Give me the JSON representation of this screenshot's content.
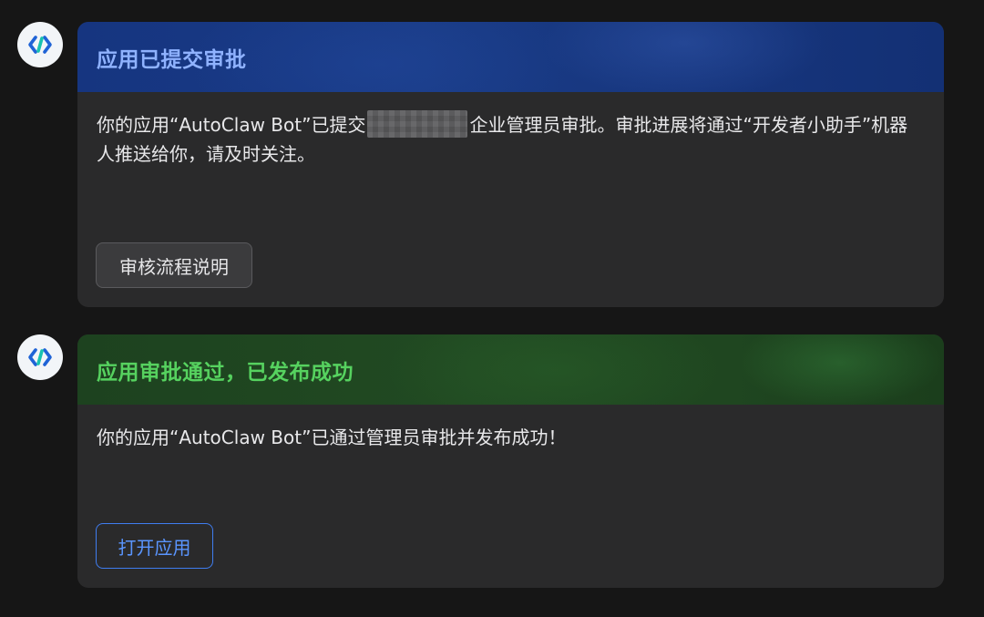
{
  "messages": [
    {
      "avatar_icon": "code-brackets-icon",
      "header_color": "#8fb2ff",
      "title": "应用已提交审批",
      "body_before": "你的应用“AutoClaw Bot”已提交",
      "body_after": "企业管理员审批。审批进展将通过“开发者小助手”机器人推送给你，请及时关注。",
      "button_label": "审核流程说明"
    },
    {
      "avatar_icon": "code-brackets-icon",
      "header_color": "#56d25f",
      "title": "应用审批通过，已发布成功",
      "body": "你的应用“AutoClaw Bot”已通过管理员审批并发布成功！",
      "button_label": "打开应用"
    }
  ],
  "colors": {
    "background": "#161616",
    "card": "#2a2a2b",
    "primary_button": "#3f7df0",
    "icon_blue": "#1f63d6",
    "icon_teal": "#18c2b0"
  }
}
